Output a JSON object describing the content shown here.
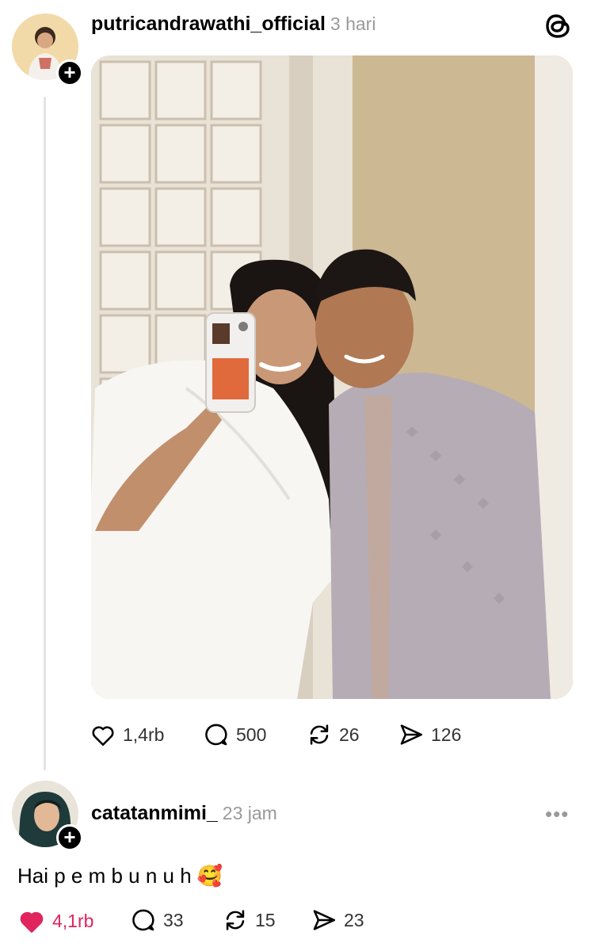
{
  "post": {
    "username": "putricandrawathi_official",
    "time": "3 hari",
    "likes": "1,4rb",
    "replies": "500",
    "reposts": "26",
    "shares": "126"
  },
  "reply": {
    "username": "catatanmimi_",
    "time": "23 jam",
    "text": "Hai p e m b u n u h",
    "emoji": "🥰",
    "likes": "4,1rb",
    "replies": "33",
    "reposts": "15",
    "shares": "23",
    "liked": true
  },
  "colors": {
    "like_active": "#e0245e",
    "muted": "#9a9a9a"
  },
  "icons": [
    "threads-logo-icon",
    "heart-icon",
    "comment-icon",
    "repost-icon",
    "share-icon",
    "plus-icon",
    "more-icon"
  ]
}
